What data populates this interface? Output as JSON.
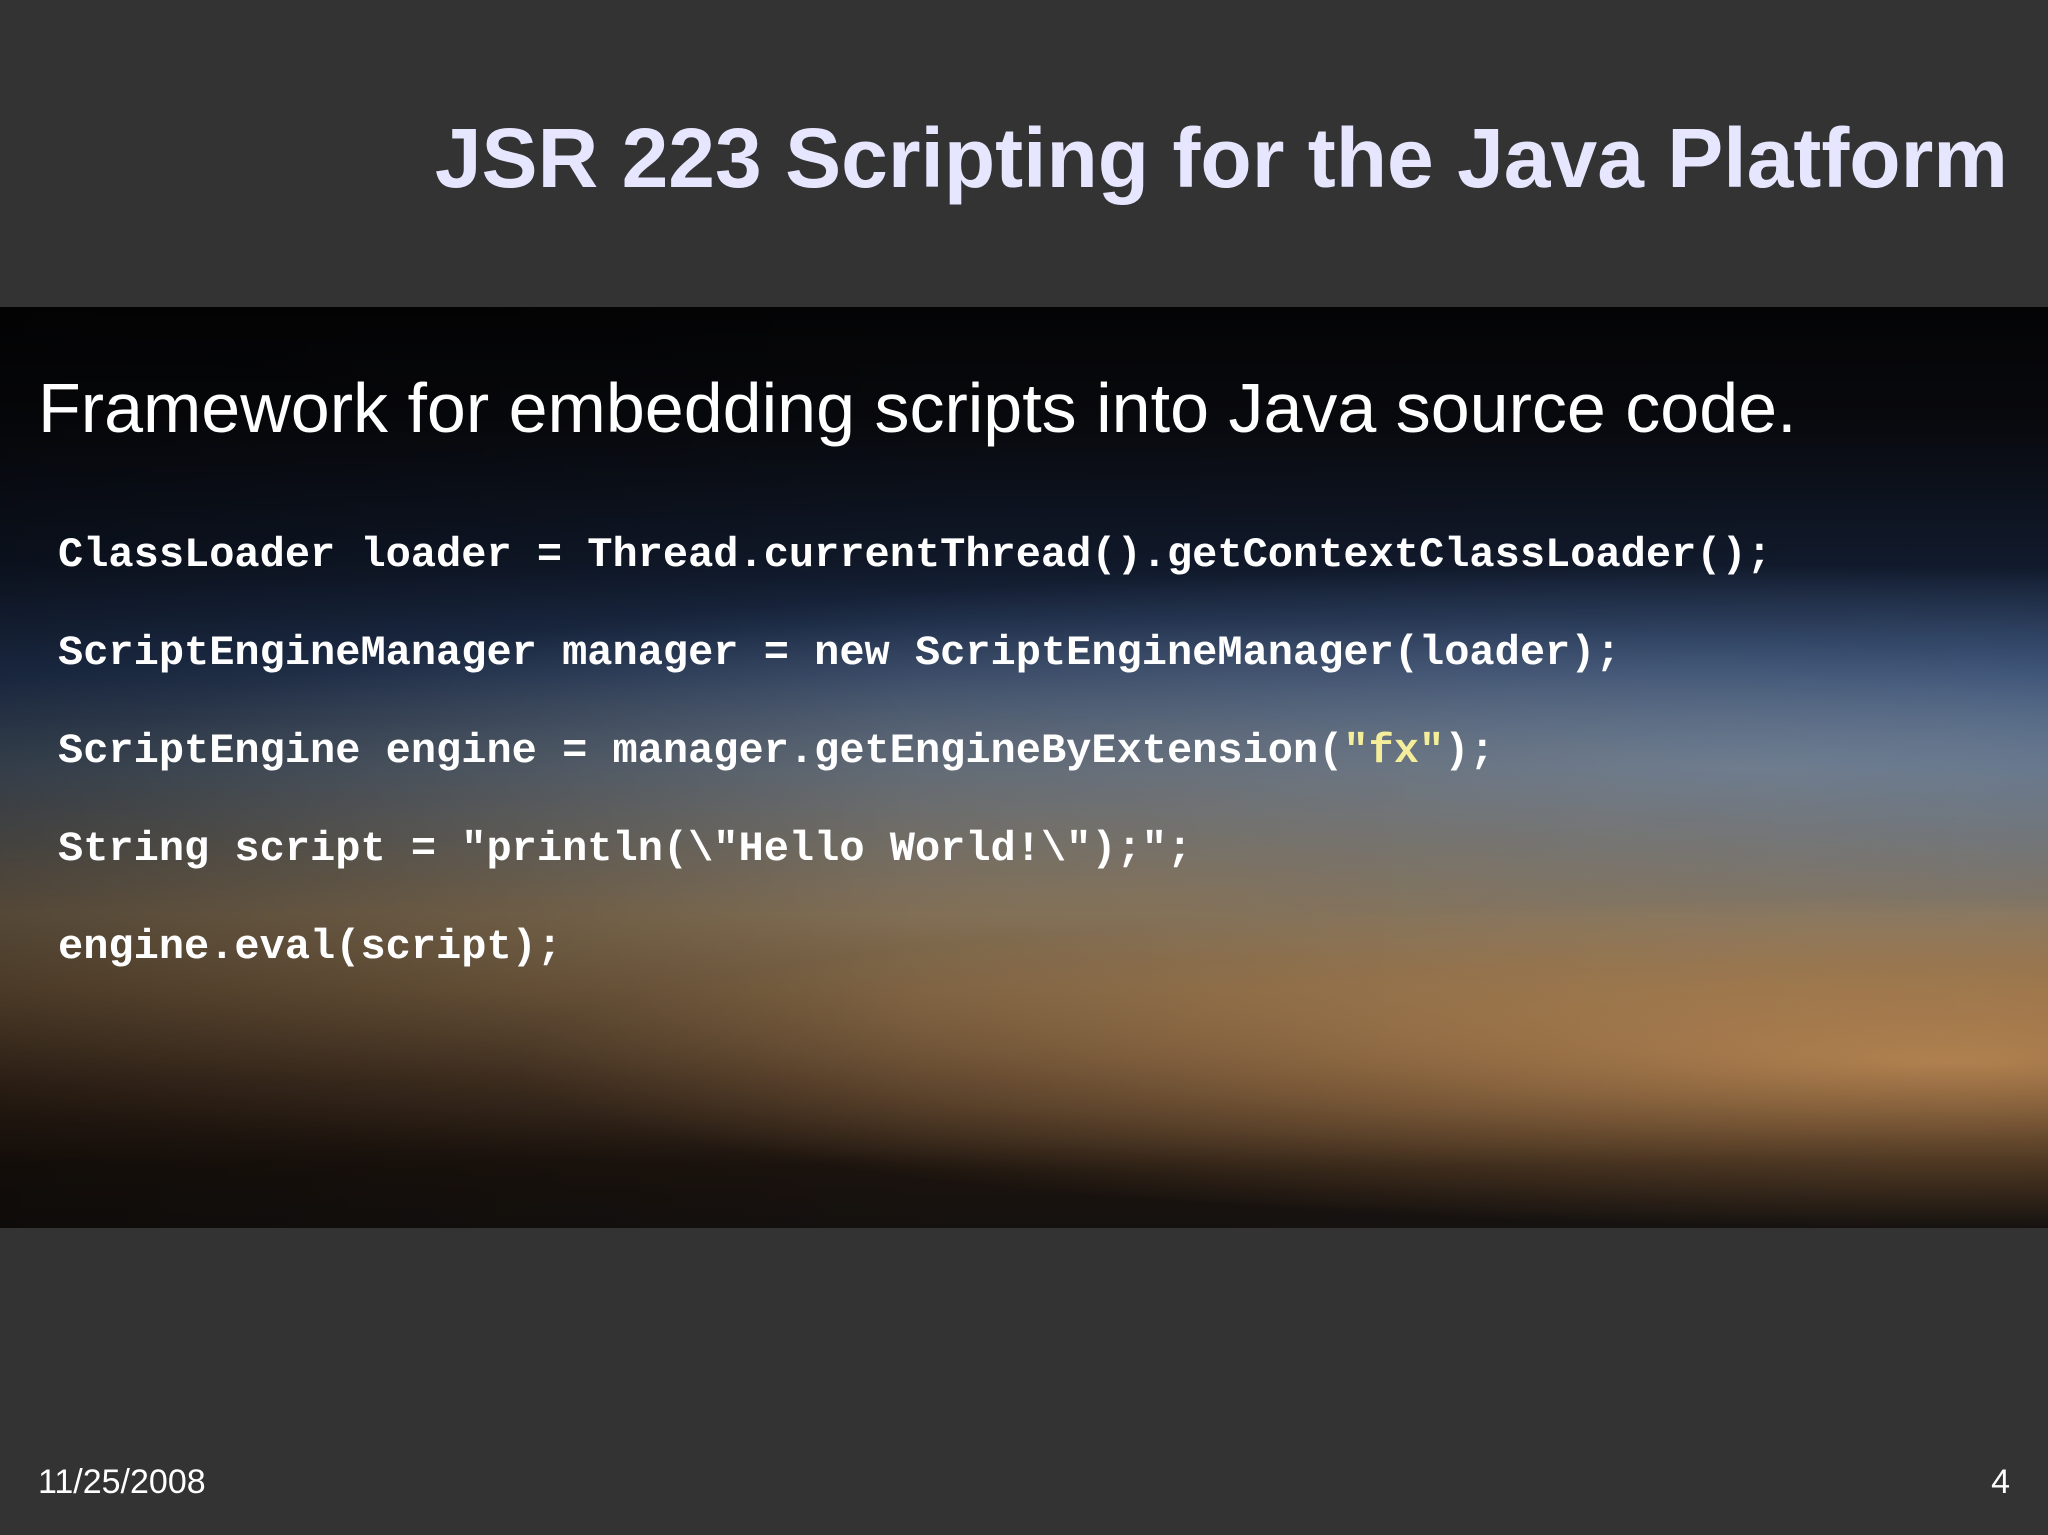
{
  "slide": {
    "title": "JSR 223 Scripting for the Java Platform",
    "subtitle": "Framework for embedding scripts into Java source code.",
    "code": {
      "line1": "ClassLoader loader = Thread.currentThread().getContextClassLoader();",
      "line2": "ScriptEngineManager manager = new ScriptEngineManager(loader);",
      "line3_pre": "ScriptEngine engine = manager.getEngineByExtension(",
      "line3_str": "\"fx\"",
      "line3_post": ");",
      "line4": "String script = \"println(\\\"Hello World!\\\");\";",
      "line5": "engine.eval(script);"
    },
    "footer": {
      "date": "11/25/2008",
      "page_number": "4"
    }
  },
  "colors": {
    "background": "#333333",
    "title": "#e6e6ff",
    "text": "#ffffff",
    "string_highlight": "#f4ee9a"
  }
}
